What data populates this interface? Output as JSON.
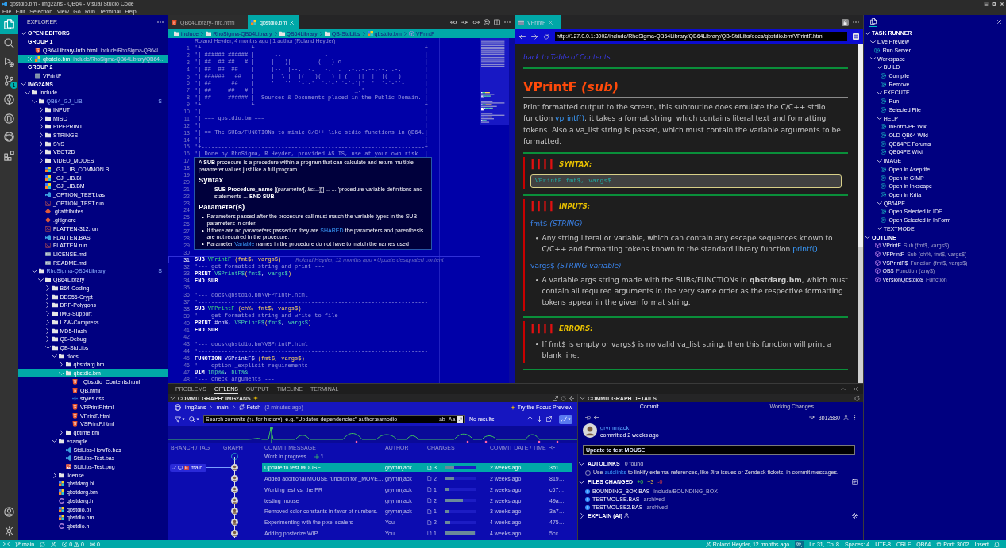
{
  "title_bar": {
    "title": "qbstdio.bm - img2ans - QB64 - Visual Studio Code"
  },
  "menu": [
    "File",
    "Edit",
    "Selection",
    "View",
    "Go",
    "Run",
    "Terminal",
    "Help"
  ],
  "activity_bar": {
    "top": [
      {
        "kind": "explorer",
        "selected": true
      },
      {
        "kind": "search",
        "selected": false
      },
      {
        "kind": "run",
        "selected": false
      },
      {
        "kind": "scm",
        "selected": false,
        "badge": "1"
      },
      {
        "kind": "gitlens",
        "selected": false
      },
      {
        "kind": "preview",
        "selected": false
      },
      {
        "kind": "github",
        "selected": false
      },
      {
        "kind": "extensions",
        "selected": false
      }
    ],
    "bottom": [
      {
        "kind": "account"
      },
      {
        "kind": "manage"
      }
    ]
  },
  "explorer": {
    "title": "EXPLORER",
    "open_editors": {
      "title": "OPEN EDITORS",
      "expanded": true,
      "groups": [
        {
          "title": "GROUP 1",
          "items": [
            {
              "name": "QB64Library-Info.html",
              "path": "include/RhoSigma-QB64L…",
              "kind": "html",
              "selected": false
            },
            {
              "name": "qbstdio.bm",
              "path": "include/RhoSigma-QB64Library/QB64…",
              "kind": "qb64",
              "selected": true
            }
          ]
        },
        {
          "title": "GROUP 2",
          "items": [
            {
              "name": "VPrintF",
              "kind": "preview",
              "selected": false
            }
          ]
        }
      ]
    },
    "workspace": {
      "title": "IMG2ANS",
      "expanded": true,
      "tree": [
        {
          "name": "include",
          "kind": "folder",
          "expanded": true,
          "selected": false,
          "children": [
            {
              "name": "QB64_GJ_LIB",
              "kind": "folder",
              "expanded": true,
              "selected": false,
              "badge": "S",
              "children": [
                {
                  "name": "INPUT",
                  "kind": "folder",
                  "expanded": false,
                  "selected": false
                },
                {
                  "name": "MISC",
                  "kind": "folder",
                  "expanded": false,
                  "selected": false
                },
                {
                  "name": "PIPEPRINT",
                  "kind": "folder",
                  "expanded": false,
                  "selected": false
                },
                {
                  "name": "STRINGS",
                  "kind": "folder",
                  "expanded": false,
                  "selected": false
                },
                {
                  "name": "SYS",
                  "kind": "folder",
                  "expanded": false,
                  "selected": false
                },
                {
                  "name": "VECT2D",
                  "kind": "folder",
                  "expanded": false,
                  "selected": false
                },
                {
                  "name": "VIDEO_MODES",
                  "kind": "folder",
                  "expanded": false,
                  "selected": false
                },
                {
                  "name": "_GJ_LIB_COMMON.BI",
                  "kind": "qb64",
                  "selected": false
                },
                {
                  "name": "_GJ_LIB.BI",
                  "kind": "qb64",
                  "selected": false
                },
                {
                  "name": "_GJ_LIB.BM",
                  "kind": "qb64",
                  "selected": false
                },
                {
                  "name": "_OPTION_TEST.bas",
                  "kind": "bas",
                  "selected": false
                },
                {
                  "name": "_OPTION_TEST.run",
                  "kind": "run",
                  "selected": false
                },
                {
                  "name": ".gitattributes",
                  "kind": "git",
                  "selected": false
                },
                {
                  "name": ".gitignore",
                  "kind": "git",
                  "selected": false
                },
                {
                  "name": "FLATTEN-312.run",
                  "kind": "run",
                  "selected": false
                },
                {
                  "name": "FLATTEN.BAS",
                  "kind": "bas",
                  "selected": false
                },
                {
                  "name": "FLATTEN.run",
                  "kind": "run",
                  "selected": false
                },
                {
                  "name": "LICENSE.md",
                  "kind": "md",
                  "selected": false
                },
                {
                  "name": "README.md",
                  "kind": "md",
                  "selected": false
                }
              ]
            },
            {
              "name": "RhoSigma-QB64Library",
              "kind": "folder",
              "expanded": true,
              "selected": false,
              "badge": "S",
              "children": [
                {
                  "name": "QB64Library",
                  "kind": "folder",
                  "expanded": true,
                  "selected": false,
                  "children": [
                    {
                      "name": "B64-Coding",
                      "kind": "folder",
                      "expanded": false,
                      "selected": false
                    },
                    {
                      "name": "DES56-Crypt",
                      "kind": "folder",
                      "expanded": false,
                      "selected": false
                    },
                    {
                      "name": "DRF-Polygons",
                      "kind": "folder",
                      "expanded": false,
                      "selected": false
                    },
                    {
                      "name": "IMG-Support",
                      "kind": "folder",
                      "expanded": false,
                      "selected": false
                    },
                    {
                      "name": "LZW-Compress",
                      "kind": "folder",
                      "expanded": false,
                      "selected": false
                    },
                    {
                      "name": "MD5-Hash",
                      "kind": "folder",
                      "expanded": false,
                      "selected": false
                    },
                    {
                      "name": "QB-Debug",
                      "kind": "folder",
                      "expanded": false,
                      "selected": false
                    },
                    {
                      "name": "QB-StdLibs",
                      "kind": "folder",
                      "expanded": true,
                      "selected": false,
                      "children": [
                        {
                          "name": "docs",
                          "kind": "folder",
                          "expanded": true,
                          "selected": false,
                          "children": [
                            {
                              "name": "qbstdarg.bm",
                              "kind": "folder",
                              "expanded": false,
                              "selected": false
                            },
                            {
                              "name": "qbstdio.bm",
                              "kind": "folder",
                              "expanded": true,
                              "selected": true,
                              "children": [
                                {
                                  "name": "_Qbstdio_Contents.html",
                                  "kind": "html",
                                  "selected": false
                                },
                                {
                                  "name": "QB.html",
                                  "kind": "html",
                                  "selected": false
                                },
                                {
                                  "name": "styles.css",
                                  "kind": "css",
                                  "selected": false
                                },
                                {
                                  "name": "VFPrintF.html",
                                  "kind": "html",
                                  "selected": false
                                },
                                {
                                  "name": "VPrintF.html",
                                  "kind": "html",
                                  "selected": false
                                },
                                {
                                  "name": "VSPrintF.html",
                                  "kind": "html",
                                  "selected": false
                                }
                              ]
                            },
                            {
                              "name": "qbtime.bm",
                              "kind": "folder",
                              "expanded": false,
                              "selected": false
                            }
                          ]
                        },
                        {
                          "name": "example",
                          "kind": "folder",
                          "expanded": true,
                          "selected": false,
                          "children": [
                            {
                              "name": "StdLibs-HowTo.bas",
                              "kind": "bas",
                              "selected": false
                            },
                            {
                              "name": "StdLibs-Test.bas",
                              "kind": "bas",
                              "selected": false
                            },
                            {
                              "name": "StdLibs-Test.png",
                              "kind": "png",
                              "selected": false
                            }
                          ]
                        },
                        {
                          "name": "license",
                          "kind": "folder",
                          "expanded": false,
                          "selected": false
                        },
                        {
                          "name": "qbstdarg.bi",
                          "kind": "qb64",
                          "selected": false
                        },
                        {
                          "name": "qbstdarg.bm",
                          "kind": "qb64",
                          "selected": false
                        },
                        {
                          "name": "qbstdarg.h",
                          "kind": "c",
                          "selected": false
                        },
                        {
                          "name": "qbstdio.bi",
                          "kind": "qb64",
                          "selected": false
                        },
                        {
                          "name": "qbstdio.bm",
                          "kind": "qb64",
                          "selected": false
                        },
                        {
                          "name": "qbstdio.h",
                          "kind": "c",
                          "selected": false
                        }
                      ]
                    }
                  ]
                }
              ]
            }
          ]
        }
      ]
    }
  },
  "editor": {
    "tabs": [
      {
        "label": "QB64Library-Info.html",
        "kind": "html",
        "selected": false
      },
      {
        "label": "qbstdio.bm",
        "kind": "qb64",
        "selected": true
      }
    ],
    "breadcrumb": [
      {
        "label": "include",
        "kind": "folder"
      },
      {
        "label": "RhoSigma-QB64Library",
        "kind": "folder"
      },
      {
        "label": "QB64Library",
        "kind": "folder"
      },
      {
        "label": "QB-StdLibs",
        "kind": "folder"
      },
      {
        "label": "qbstdio.bm",
        "kind": "qb64"
      },
      {
        "label": "VPrintF",
        "kind": "symbol"
      }
    ],
    "blame": "Roland Heyder, 4 months ago | 1 author (Roland Heyder)",
    "lines": [
      {
        "number": "1",
        "current": false,
        "tokens": [
          {
            "kind": "comment",
            "text": "'+---------------+---------------------------------------------------+"
          }
        ]
      },
      {
        "number": "2",
        "current": false,
        "tokens": [
          {
            "kind": "comment",
            "text": "'| ###### ###### |     .--. .         .-.                            |"
          }
        ]
      },
      {
        "number": "3",
        "current": false,
        "tokens": [
          {
            "kind": "comment",
            "text": "'| ##  ## ##   # |     |   )|        (   ) o                         |"
          }
        ]
      },
      {
        "number": "4",
        "current": false,
        "tokens": [
          {
            "kind": "comment",
            "text": "'| ##  ##  ##    |     |--' |--. .-.  `-.  .  .-..-.--.--. .-.       |"
          }
        ]
      },
      {
        "number": "5",
        "current": false,
        "tokens": [
          {
            "kind": "comment",
            "text": "'| ######   ##   |     |  \\ |  |(   )(   ) | (   ||  |  |(   )       |"
          }
        ]
      },
      {
        "number": "6",
        "current": false,
        "tokens": [
          {
            "kind": "comment",
            "text": "'| ##      ##    |     '   `'  `-`-'  `-'-' `-`-`|'  '  `-`-'`-      |"
          }
        ]
      },
      {
        "number": "7",
        "current": false,
        "tokens": [
          {
            "kind": "comment",
            "text": "'| ##     ##   # |                             ._.'                  |"
          }
        ]
      },
      {
        "number": "8",
        "current": false,
        "tokens": [
          {
            "kind": "comment",
            "text": "'| ##     ###### |  Sources & Documents placed in the Public Domain. |"
          }
        ]
      },
      {
        "number": "9",
        "current": false,
        "tokens": [
          {
            "kind": "comment",
            "text": "'+---------------+---------------------------------------------------+"
          }
        ]
      },
      {
        "number": "10",
        "current": false,
        "tokens": [
          {
            "kind": "comment",
            "text": "'|                                                                   |"
          }
        ]
      },
      {
        "number": "11",
        "current": false,
        "tokens": [
          {
            "kind": "comment",
            "text": "'| === qbstdio.bm ===                                                |"
          }
        ]
      },
      {
        "number": "12",
        "current": false,
        "tokens": [
          {
            "kind": "comment",
            "text": "'|                                                                   |"
          }
        ]
      },
      {
        "number": "13",
        "current": false,
        "tokens": [
          {
            "kind": "comment",
            "text": "'| == The SUBs/FUNCTIONs to mimic C/C++ like stdio functions in QB64.|"
          }
        ]
      },
      {
        "number": "14",
        "current": false,
        "tokens": [
          {
            "kind": "comment",
            "text": "'|                                                                   |"
          }
        ]
      },
      {
        "number": "15",
        "current": false,
        "tokens": [
          {
            "kind": "comment",
            "text": "'+-------------------------------------------------------------------+"
          }
        ]
      },
      {
        "number": "16",
        "current": false,
        "tokens": [
          {
            "kind": "comment",
            "text": "'| Done by RhoSigma, R.Heyder, provided AS IS, use at your own risk. |"
          }
        ]
      },
      {
        "number": "17",
        "current": false
      },
      {
        "number": "18",
        "current": false
      },
      {
        "number": "19",
        "current": false
      },
      {
        "number": "20",
        "current": false
      },
      {
        "number": "21",
        "current": false
      },
      {
        "number": "22",
        "current": false
      },
      {
        "number": "23",
        "current": false
      },
      {
        "number": "24",
        "current": false
      },
      {
        "number": "25",
        "current": false
      },
      {
        "number": "26",
        "current": false
      },
      {
        "number": "27",
        "current": false
      },
      {
        "number": "28",
        "current": false
      },
      {
        "number": "29",
        "current": false
      },
      {
        "number": "30",
        "current": false
      },
      {
        "number": "31",
        "current": true,
        "tokens": [
          {
            "kind": "keyword",
            "text": "SUB "
          },
          {
            "kind": "function",
            "text": "VPrintF "
          },
          {
            "kind": "param",
            "text": "(fmt$, vargs$)"
          }
        ],
        "blame": "Roland Heyder, 12 months ago • Update designated content"
      },
      {
        "number": "32",
        "current": false,
        "tokens": [
          {
            "kind": "comment",
            "text": "'--- get formatted string and print ---"
          }
        ]
      },
      {
        "number": "33",
        "current": false,
        "tokens": [
          {
            "kind": "keyword",
            "text": "PRINT "
          },
          {
            "kind": "var",
            "text": "VSPrintF$"
          },
          {
            "kind": "param",
            "text": "("
          },
          {
            "kind": "var",
            "text": "fmt$"
          },
          {
            "kind": "plain",
            "text": ", "
          },
          {
            "kind": "var",
            "text": "vargs$"
          },
          {
            "kind": "param",
            "text": ")"
          }
        ]
      },
      {
        "number": "34",
        "current": false,
        "tokens": [
          {
            "kind": "keyword",
            "text": "END SUB"
          }
        ]
      },
      {
        "number": "35",
        "current": false
      },
      {
        "number": "36",
        "current": false,
        "tokens": [
          {
            "kind": "comment",
            "text": "'--- docs\\qbstdio.bm\\VFPrintF.html"
          }
        ]
      },
      {
        "number": "37",
        "current": false,
        "tokens": [
          {
            "kind": "comment",
            "text": "'---------------------------------------------------------------------"
          }
        ]
      },
      {
        "number": "38",
        "current": false,
        "tokens": [
          {
            "kind": "keyword",
            "text": "SUB "
          },
          {
            "kind": "function",
            "text": "VFPrintF "
          },
          {
            "kind": "param",
            "text": "(ch%, fmt$, vargs$)"
          }
        ]
      },
      {
        "number": "39",
        "current": false,
        "tokens": [
          {
            "kind": "comment",
            "text": "'--- get formatted string and write to file ---"
          }
        ]
      },
      {
        "number": "40",
        "current": false,
        "tokens": [
          {
            "kind": "keyword",
            "text": "PRINT "
          },
          {
            "kind": "plain",
            "text": "#ch%, "
          },
          {
            "kind": "var",
            "text": "VSPrintF$"
          },
          {
            "kind": "param",
            "text": "("
          },
          {
            "kind": "var",
            "text": "fmt$"
          },
          {
            "kind": "plain",
            "text": ", "
          },
          {
            "kind": "var",
            "text": "vargs$"
          },
          {
            "kind": "param",
            "text": ")"
          }
        ]
      },
      {
        "number": "41",
        "current": false,
        "tokens": [
          {
            "kind": "keyword",
            "text": "END SUB"
          }
        ]
      },
      {
        "number": "42",
        "current": false
      },
      {
        "number": "43",
        "current": false,
        "tokens": [
          {
            "kind": "comment",
            "text": "'--- docs\\qbstdio.bm\\VSPrintF.html"
          }
        ]
      },
      {
        "number": "44",
        "current": false,
        "tokens": [
          {
            "kind": "comment",
            "text": "'---------------------------------------------------------------------"
          }
        ]
      },
      {
        "number": "45",
        "current": false,
        "tokens": [
          {
            "kind": "keyword",
            "text": "FUNCTION "
          },
          {
            "kind": "plain",
            "text": "VSPrintF$ "
          },
          {
            "kind": "param",
            "text": "(fmt$, vargs$)"
          }
        ]
      },
      {
        "number": "46",
        "current": false,
        "tokens": [
          {
            "kind": "comment",
            "text": "'--- option _explicit requirements ---"
          }
        ]
      },
      {
        "number": "47",
        "current": false,
        "tokens": [
          {
            "kind": "keyword",
            "text": "DIM "
          },
          {
            "kind": "var",
            "text": "tmp%&"
          },
          {
            "kind": "plain",
            "text": ", "
          },
          {
            "kind": "var",
            "text": "buf%&"
          }
        ]
      },
      {
        "number": "48",
        "current": false,
        "tokens": [
          {
            "kind": "comment",
            "text": "'--- check arguments ---"
          }
        ]
      }
    ],
    "hover": {
      "intro": "A **SUB** procedure is a procedure within a program that can calculate and return multiple parameter values just like a full program.",
      "syntax_heading": "Syntax",
      "syntax": "**SUB Procedure_name** [(*parameter*[, *list*...])] ... ... 'procedure variable definitions and statements ... **END SUB**",
      "params_heading": "Parameter(s)",
      "bullets": [
        [
          {
            "kind": "text",
            "text": "Parameters passed after the procedure call must match the variable types in the SUB parameters in order."
          }
        ],
        [
          {
            "kind": "text",
            "text": "If there are no *parameters* passed or they are "
          },
          {
            "kind": "link",
            "text": "SHARED"
          },
          {
            "kind": "text",
            "text": " the parameters and parenthesis are not required in the procedure."
          }
        ],
        [
          {
            "kind": "text",
            "text": "Parameter "
          },
          {
            "kind": "link",
            "text": "Variable"
          },
          {
            "kind": "text",
            "text": " names in the procedure do not have to match the names used"
          }
        ]
      ]
    }
  },
  "preview": {
    "tab": {
      "label": "VPrintF",
      "selected": true
    },
    "url": "http://127.0.0.1:3002/include/RhoSigma-QB64Library/QB64Library/QB-StdLibs/docs/qbstdio.bm/VPrintF.html",
    "back_link": "back to Table of Contents",
    "heading": "VPrintF *(sub)*",
    "description": [
      {
        "kind": "text",
        "text": "Print formatted output to the screen, this subroutine does emulate the C/C++ stdio function "
      },
      {
        "kind": "link",
        "text": "vprintf()"
      },
      {
        "kind": "text",
        "text": ", it takes a format string, which contains literal text and formatting tokens. Also a va_list string is passed, which must contain the variable arguments to be formatted."
      }
    ],
    "sections": [
      {
        "heading": "SYNTAX:",
        "blocks": [
          {
            "kind": "code",
            "text": "VPrintF fmt$, vargs$"
          }
        ]
      },
      {
        "heading": "INPUTS:",
        "blocks": [
          {
            "kind": "param",
            "text": "fmt$ *(STRING)*"
          },
          {
            "kind": "bullet",
            "parts": [
              {
                "kind": "text",
                "text": "Any string literal or variable, which can contain any escape sequences known to C/C++ and formatting tokens known to the standard library function "
              },
              {
                "kind": "link",
                "text": "printf()"
              },
              {
                "kind": "text",
                "text": "."
              }
            ]
          },
          {
            "kind": "param",
            "text": "vargs$ *(STRING variable)*"
          },
          {
            "kind": "bullet",
            "parts": [
              {
                "kind": "text",
                "text": "A variable args string made with the SUBs/FUNCTIONs in **qbstdarg.bm**, which must contain all required arguments in the very same order as the respective formatting tokens appear in the given format string."
              }
            ]
          }
        ]
      },
      {
        "heading": "ERRORS:",
        "blocks": [
          {
            "kind": "bullet",
            "parts": [
              {
                "kind": "text",
                "text": "If fmt$ is empty or vargs$ is no valid va_list string, then this function will print a blank line."
              }
            ]
          }
        ]
      }
    ]
  },
  "right_panel": {
    "task_runner": {
      "title": "TASK RUNNER",
      "expanded": true,
      "items": [
        {
          "label": "Live Preview",
          "kind": "group",
          "expanded": true,
          "children": [
            {
              "label": "Run Server",
              "kind": "task"
            }
          ]
        },
        {
          "label": "Workspace",
          "kind": "group",
          "expanded": true,
          "children": [
            {
              "label": "BUILD",
              "kind": "group",
              "expanded": true,
              "children": [
                {
                  "label": "Compile",
                  "kind": "task"
                },
                {
                  "label": "Remove",
                  "kind": "task"
                }
              ]
            },
            {
              "label": "EXECUTE",
              "kind": "group",
              "expanded": true,
              "children": [
                {
                  "label": "Run",
                  "kind": "task"
                },
                {
                  "label": "Selected File",
                  "kind": "task"
                }
              ]
            },
            {
              "label": "HELP",
              "kind": "group",
              "expanded": true,
              "children": [
                {
                  "label": "InForm-PE Wiki",
                  "kind": "task"
                },
                {
                  "label": "OLD QB64 Wiki",
                  "kind": "task"
                },
                {
                  "label": "QB64PE Forums",
                  "kind": "task"
                },
                {
                  "label": "QB64PE Wiki",
                  "kind": "task"
                }
              ]
            },
            {
              "label": "IMAGE",
              "kind": "group",
              "expanded": true,
              "children": [
                {
                  "label": "Open in Aseprite",
                  "kind": "task"
                },
                {
                  "label": "Open in GIMP",
                  "kind": "task"
                },
                {
                  "label": "Open in Inkscape",
                  "kind": "task"
                },
                {
                  "label": "Open in Krita",
                  "kind": "task"
                }
              ]
            },
            {
              "label": "QB64PE",
              "kind": "group",
              "expanded": true,
              "children": [
                {
                  "label": "Open Selected in IDE",
                  "kind": "task"
                },
                {
                  "label": "Open Selected in InForm",
                  "kind": "task"
                }
              ]
            },
            {
              "label": "TEXTMODE",
              "kind": "group",
              "expanded": true
            }
          ]
        }
      ]
    },
    "outline": {
      "title": "OUTLINE",
      "expanded": true,
      "items": [
        {
          "label": "VPrintF",
          "detail": "Sub (fmt$, vargs$)"
        },
        {
          "label": "VFPrintF",
          "detail": "Sub (ch%, fmt$, vargs$)"
        },
        {
          "label": "VSPrintF$",
          "detail": "Function (fmt$, vargs$)"
        },
        {
          "label": "QB$",
          "detail": "Function (any$)"
        },
        {
          "label": "VersionQbstdio$",
          "detail": "Function"
        }
      ]
    }
  },
  "panel": {
    "tabs": [
      {
        "label": "PROBLEMS",
        "selected": false
      },
      {
        "label": "GITLENS",
        "selected": true
      },
      {
        "label": "OUTPUT",
        "selected": false
      },
      {
        "label": "TIMELINE",
        "selected": false
      },
      {
        "label": "TERMINAL",
        "selected": false
      }
    ],
    "graph": {
      "title": "COMMIT GRAPH: IMG2ANS",
      "repo": "img2ans",
      "branch": "main",
      "fetch": "Fetch",
      "fetch_time": "(2 minutes ago)",
      "focus": "Try the Focus Preview",
      "search": {
        "placeholder": "Search commits (↑↓ for history), e.g. \"Updates dependencies\" author:eamodio"
      },
      "toggles": [
        {
          "label": "ab",
          "selected": false
        },
        {
          "label": "Aa",
          "selected": false
        },
        {
          "label": ".*",
          "selected": true
        }
      ],
      "status": "No results",
      "chart_toggle": {
        "selected": true
      },
      "columns": [
        "BRANCH / TAG",
        "GRAPH",
        "COMMIT MESSAGE",
        "AUTHOR",
        "CHANGES",
        "COMMIT DATE / TIME"
      ],
      "rows": [
        {
          "kind": "wip",
          "message": "Work in progress",
          "count": "1",
          "selected": false
        },
        {
          "kind": "commit",
          "branch": "main",
          "message": "Update to test MOUSE",
          "author": "grymmjack",
          "files": "3",
          "level": 0.3,
          "date": "2 weeks ago",
          "sha": "3b1…",
          "selected": true
        },
        {
          "kind": "commit",
          "message": "Added additional MOUSE function for _MOVE…",
          "author": "grymmjack",
          "files": "2",
          "level": 0.3,
          "date": "2 weeks ago",
          "sha": "819…",
          "selected": false
        },
        {
          "kind": "commit",
          "message": "Working test vs. the PR",
          "author": "grymmjack",
          "files": "1",
          "level": 0.13,
          "date": "2 weeks ago",
          "sha": "c67…",
          "selected": false
        },
        {
          "kind": "commit",
          "message": "testing mouse",
          "author": "grymmjack",
          "files": "2",
          "level": 0.58,
          "date": "2 weeks ago",
          "sha": "49a…",
          "selected": false
        },
        {
          "kind": "commit",
          "message": "Removed color constants in favor of numbers.",
          "author": "grymmjack",
          "files": "1",
          "level": 0.13,
          "date": "3 weeks ago",
          "sha": "3a7…",
          "selected": false
        },
        {
          "kind": "commit",
          "message": "Experimenting with the pixel scalers",
          "author": "You",
          "files": "2",
          "level": 0.17,
          "date": "4 weeks ago",
          "sha": "475…",
          "selected": false
        },
        {
          "kind": "commit",
          "message": "Adding posterize WIP",
          "author": "You",
          "files": "1",
          "level": 0.95,
          "date": "4 weeks ago",
          "sha": "5cc…",
          "selected": false
        }
      ]
    },
    "details": {
      "title": "COMMIT GRAPH DETAILS",
      "tabs": [
        {
          "label": "Commit",
          "selected": true
        },
        {
          "label": "Working Changes",
          "selected": false
        }
      ],
      "sha": "3b12880",
      "author": "grymmjack",
      "committed": "committed 2 weeks ago",
      "message": "Update to test MOUSE",
      "autolinks": {
        "title": "AUTOLINKS",
        "expanded": true,
        "count": "0 found",
        "text": [
          {
            "kind": "text",
            "text": "Use "
          },
          {
            "kind": "link",
            "text": "autolinks"
          },
          {
            "kind": "text",
            "text": " to linkify external references, like Jira issues or Zendesk tickets, in commit messages."
          }
        ]
      },
      "files_changed": {
        "title": "FILES CHANGED",
        "expanded": true,
        "added": "+0",
        "modified": "~3",
        "deleted": "-0",
        "items": [
          {
            "name": "BOUNDING_BOX.BAS",
            "path": "include/BOUNDING_BOX"
          },
          {
            "name": "TESTMOUSE.BAS",
            "path": "archived"
          },
          {
            "name": "TESTMOUSE2.BAS",
            "path": "archived"
          }
        ]
      },
      "explain": {
        "title": "EXPLAIN (AI)",
        "expanded": false
      }
    }
  },
  "status_bar": {
    "left": [
      {
        "kind": "remote"
      },
      {
        "kind": "branch",
        "text": "main"
      },
      {
        "kind": "sync"
      },
      {
        "kind": "liveshare"
      },
      {
        "kind": "problems",
        "errors": "0",
        "warnings": "0"
      },
      {
        "kind": "ports",
        "text": "0"
      }
    ],
    "right": [
      {
        "kind": "blame",
        "text": "Roland Heyder, 12 months ago"
      },
      {
        "kind": "zoom"
      },
      {
        "kind": "text",
        "text": "Ln 31, Col 8"
      },
      {
        "kind": "text",
        "text": "Spaces: 4"
      },
      {
        "kind": "text",
        "text": "UTF-8"
      },
      {
        "kind": "text",
        "text": "CRLF"
      },
      {
        "kind": "text",
        "text": "QB64"
      },
      {
        "kind": "port",
        "text": "Port: 3002"
      },
      {
        "kind": "text",
        "text": "Insert"
      },
      {
        "kind": "bell"
      }
    ]
  }
}
